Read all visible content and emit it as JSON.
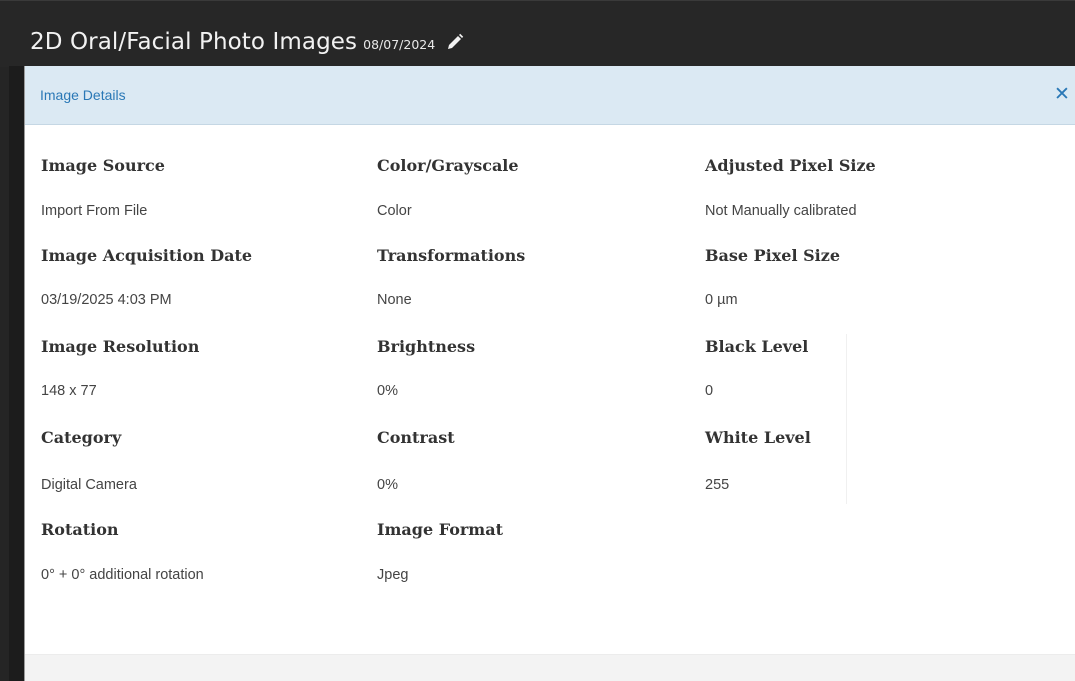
{
  "header": {
    "title": "2D Oral/Facial Photo Images",
    "date": "08/07/2024",
    "edit_icon": "pencil-icon"
  },
  "dialog": {
    "title": "Image Details",
    "close_label": "✕",
    "close_icon": "close-icon",
    "accent_color": "#2a78b6",
    "header_bg": "#dbe9f3",
    "fields": {
      "image_source": {
        "label": "Image Source",
        "value": "Import From File"
      },
      "color_grayscale": {
        "label": "Color/Grayscale",
        "value": "Color"
      },
      "adjusted_pixel_size": {
        "label": "Adjusted Pixel Size",
        "value": "Not Manually calibrated"
      },
      "image_acquisition_date": {
        "label": "Image Acquisition Date",
        "value": "03/19/2025 4:03 PM"
      },
      "transformations": {
        "label": "Transformations",
        "value": "None"
      },
      "base_pixel_size": {
        "label": "Base Pixel Size",
        "value": "0 µm"
      },
      "image_resolution": {
        "label": "Image Resolution",
        "value": "148 x 77"
      },
      "brightness": {
        "label": "Brightness",
        "value": "0%"
      },
      "black_level": {
        "label": "Black Level",
        "value": "0"
      },
      "category": {
        "label": "Category",
        "value": "Digital Camera"
      },
      "contrast": {
        "label": "Contrast",
        "value": "0%"
      },
      "white_level": {
        "label": "White Level",
        "value": "255"
      },
      "rotation": {
        "label": "Rotation",
        "value": "0° + 0° additional rotation"
      },
      "image_format": {
        "label": "Image Format",
        "value": "Jpeg"
      }
    }
  }
}
